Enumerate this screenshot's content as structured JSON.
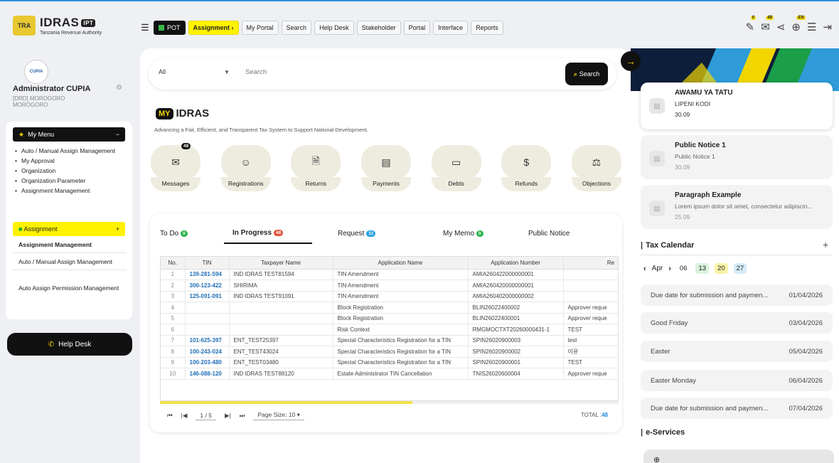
{
  "brand": {
    "name": "IDRAS",
    "badge": "IPT",
    "subtitle": "Tanzania Revenue Authority"
  },
  "nav": {
    "menu_icon": "hamburger-icon",
    "pot_label": "POT",
    "items": [
      "Assignment",
      "My Portal",
      "Search",
      "Help Desk",
      "Stakeholder",
      "Portal",
      "Interface",
      "Reports"
    ],
    "active": "Assignment"
  },
  "top_icons": [
    {
      "name": "tasks-icon",
      "badge": "0"
    },
    {
      "name": "mail-icon",
      "badge": "48"
    },
    {
      "name": "share-icon",
      "badge": ""
    },
    {
      "name": "language-icon",
      "badge": "EN"
    },
    {
      "name": "filter-settings-icon",
      "badge": ""
    },
    {
      "name": "logout-icon",
      "badge": ""
    }
  ],
  "user": {
    "avatar_text": "CUPIA",
    "name": "Administrator CUPIA",
    "location": "[DRD] MOROGORO MOROGORO"
  },
  "sidebar": {
    "my_menu_label": "My Menu",
    "my_menu_items": [
      "Auto / Manual Assign Management",
      "My Approval",
      "Organization",
      "Organization Parameter",
      "Assignment Management"
    ],
    "assignment_label": "Assignment",
    "assignment_items": [
      "Assignment Management",
      "Auto / Manual Assign Management",
      "Auto Assign Permission Management"
    ],
    "help_desk_label": "Help Desk"
  },
  "search": {
    "scope": "All",
    "placeholder": "Search",
    "button": "Search"
  },
  "my_idras": {
    "tag": "MY",
    "title": "IDRAS",
    "tagline": "Advancing a Fair, Efficient, and Transparent Tax System to Support National Development."
  },
  "tiles": [
    {
      "label": "Messages",
      "icon": "envelope-icon",
      "badge": "48"
    },
    {
      "label": "Registrations",
      "icon": "registration-icon",
      "badge": ""
    },
    {
      "label": "Returns",
      "icon": "returns-icon",
      "badge": ""
    },
    {
      "label": "Payments",
      "icon": "payments-icon",
      "badge": ""
    },
    {
      "label": "Debts",
      "icon": "debts-icon",
      "badge": ""
    },
    {
      "label": "Refunds",
      "icon": "refunds-icon",
      "badge": ""
    },
    {
      "label": "Objections",
      "icon": "objections-icon",
      "badge": ""
    }
  ],
  "tabs": [
    {
      "label": "To Do",
      "count": "0",
      "color": "#2bb34a"
    },
    {
      "label": "In Progress",
      "count": "48",
      "color": "#e0523a"
    },
    {
      "label": "Request",
      "count": "11",
      "color": "#29a3e0"
    },
    {
      "label": "My Memo",
      "count": "0",
      "color": "#2bb34a"
    },
    {
      "label": "Public Notice",
      "count": "",
      "color": ""
    }
  ],
  "table": {
    "columns": [
      "No.",
      "TIN",
      "Taxpayer Name",
      "Application Name",
      "Application Number",
      "Re"
    ],
    "rows": [
      [
        "1",
        "139-281-594",
        "IND IDRAS TEST81594",
        "TIN Amendment",
        "AMIA260422000000001",
        ""
      ],
      [
        "2",
        "300-123-422",
        "SHIRIMA",
        "TIN Amendment",
        "AMIA260420000000001",
        ""
      ],
      [
        "3",
        "125-091-091",
        "IND IDRAS TEST91091",
        "TIN Amendment",
        "AMIA260402000000002",
        ""
      ],
      [
        "4",
        "",
        "",
        "Block Registration",
        "BLIN26022400002",
        "Approver reque"
      ],
      [
        "5",
        "",
        "",
        "Block Registration",
        "BLIN26022400001",
        "Approver reque"
      ],
      [
        "6",
        "",
        "",
        "Risk Context",
        "RMGMOCTXT20260000431-1",
        "TEST"
      ],
      [
        "7",
        "101-625-397",
        "ENT_TEST25397",
        "Special Characteristics Registration for a TIN",
        "SPIN26020900003",
        "test"
      ],
      [
        "8",
        "100-243-024",
        "ENT_TEST43024",
        "Special Characteristics Registration for a TIN",
        "SPIN26020900002",
        "이유"
      ],
      [
        "9",
        "100-203-480",
        "ENT_TEST03480",
        "Special Characteristics Registration for a TIN",
        "SPIN26020900001",
        "TEST"
      ],
      [
        "10",
        "146-088-120",
        "IND IDRAS TEST88120",
        "Estate Administrator TIN Cancellation",
        "TNIS26020600004",
        "Approver reque"
      ]
    ]
  },
  "pager": {
    "first": "⏮",
    "prev": "|◀",
    "page": "1 / 5",
    "next": "▶|",
    "last": "⏭",
    "page_size": "Page Size: 10",
    "total_label": "TOTAL :",
    "total": "48"
  },
  "notices": [
    {
      "title": "AWAMU YA TATU",
      "desc": "LIPENI KODI",
      "date": "30.09"
    },
    {
      "title": "Public Notice 1",
      "desc": "Public Notice 1",
      "date": "30.09"
    },
    {
      "title": "Paragraph Example",
      "desc": "Lorem ipsum dolor sit amet, consectetur adipiscin...",
      "date": "25.09"
    }
  ],
  "calendar": {
    "title": "Tax Calendar",
    "month": "Apr",
    "days": [
      {
        "d": "06",
        "color": ""
      },
      {
        "d": "13",
        "color": "#d9f2dc"
      },
      {
        "d": "20",
        "color": "#fbf3a8"
      },
      {
        "d": "27",
        "color": "#d5ecf8"
      }
    ],
    "events": [
      {
        "name": "Due date for submission and paymen...",
        "date": "01/04/2026"
      },
      {
        "name": "Good Friday",
        "date": "03/04/2026"
      },
      {
        "name": "Easter",
        "date": "05/04/2026"
      },
      {
        "name": "Easter Monday",
        "date": "06/04/2026"
      },
      {
        "name": "Due date for submission and paymen...",
        "date": "07/04/2026"
      }
    ]
  },
  "eservices": {
    "title": "e-Services"
  }
}
